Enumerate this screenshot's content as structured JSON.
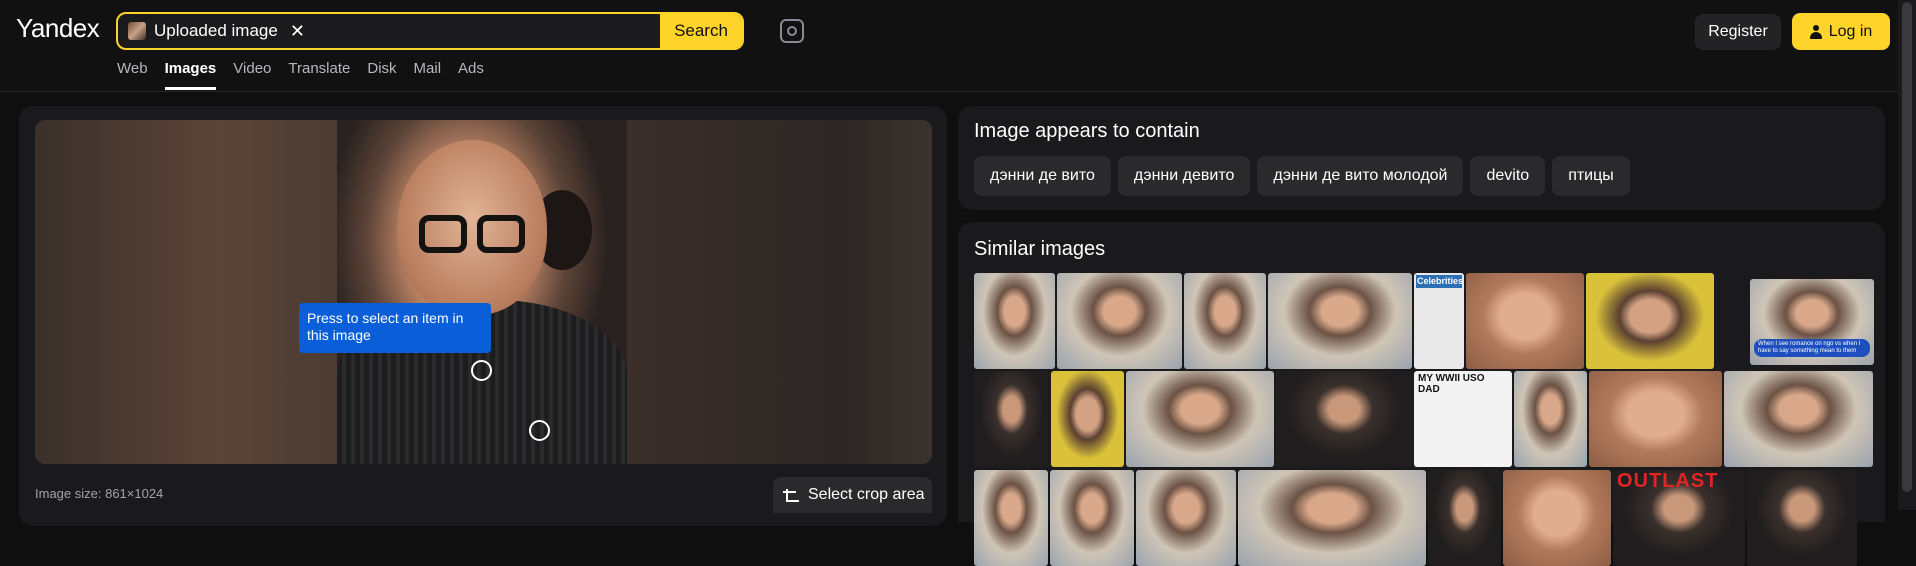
{
  "header": {
    "logo": "Yandex",
    "search_chip": "Uploaded image",
    "search_chip_remove": "✕",
    "search_button": "Search",
    "register": "Register",
    "login": "Log in"
  },
  "tabs": [
    {
      "label": "Web",
      "active": false
    },
    {
      "label": "Images",
      "active": true
    },
    {
      "label": "Video",
      "active": false
    },
    {
      "label": "Translate",
      "active": false
    },
    {
      "label": "Disk",
      "active": false
    },
    {
      "label": "Mail",
      "active": false
    },
    {
      "label": "Ads",
      "active": false
    }
  ],
  "viewer": {
    "tooltip": "Press to select an item in this image",
    "image_size": "Image size: 861×1024",
    "crop_button": "Select crop area"
  },
  "contains": {
    "heading": "Image appears to contain",
    "tags": [
      "дэнни де вито",
      "дэнни девито",
      "дэнни де вито молодой",
      "devito",
      "птицы"
    ]
  },
  "similar": {
    "heading": "Similar images",
    "captions": {
      "celebrities": "Celebrities",
      "bubble": "When I see romance on ngo vs when I have to say something mean to them",
      "wwii": "MY WWII USO DAD",
      "outlast": "OUTLAST"
    }
  },
  "colors": {
    "accent": "#fed42b",
    "tooltip": "#0a5fd8",
    "background": "#0f0f10"
  }
}
